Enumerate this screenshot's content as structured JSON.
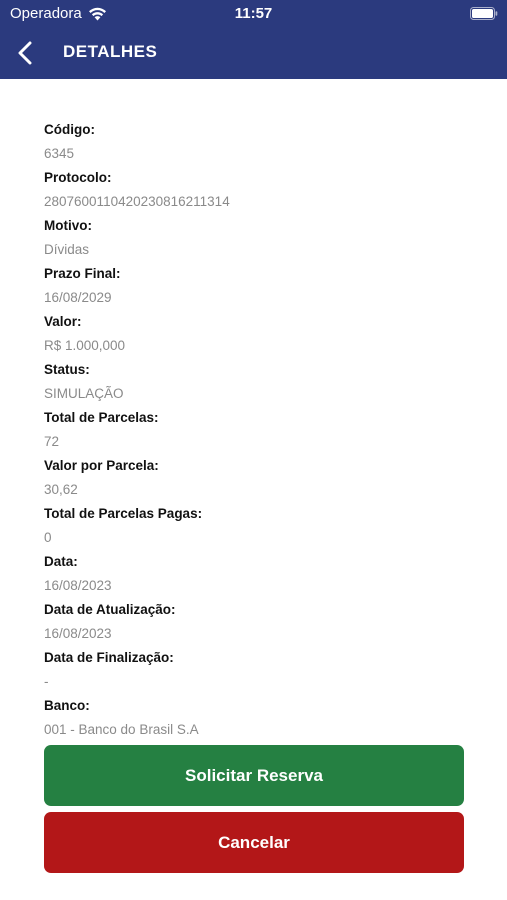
{
  "status_bar": {
    "carrier": "Operadora",
    "time": "11:57"
  },
  "nav": {
    "title": "DETALHES",
    "back_icon": "chevron-left-icon"
  },
  "details": [
    {
      "label": "Código:",
      "value": "6345"
    },
    {
      "label": "Protocolo:",
      "value": "28076001104202308162113​14"
    },
    {
      "label": "Motivo:",
      "value": "Dívidas"
    },
    {
      "label": "Prazo Final:",
      "value": "16/08/2029"
    },
    {
      "label": "Valor:",
      "value": "R$ 1.000,000"
    },
    {
      "label": "Status:",
      "value": "SIMULAÇÃO"
    },
    {
      "label": "Total de Parcelas:",
      "value": "72"
    },
    {
      "label": "Valor por Parcela:",
      "value": "30,62"
    },
    {
      "label": "Total de Parcelas Pagas:",
      "value": "0"
    },
    {
      "label": "Data:",
      "value": "16/08/2023"
    },
    {
      "label": "Data de Atualização:",
      "value": "16/08/2023"
    },
    {
      "label": "Data de Finalização:",
      "value": "-"
    },
    {
      "label": "Banco:",
      "value": "001 - Banco do Brasil S.A"
    }
  ],
  "actions": {
    "reserve_label": "Solicitar Reserva",
    "cancel_label": "Cancelar"
  },
  "colors": {
    "header": "#2b3a7e",
    "reserve": "#258042",
    "cancel": "#b31718"
  }
}
